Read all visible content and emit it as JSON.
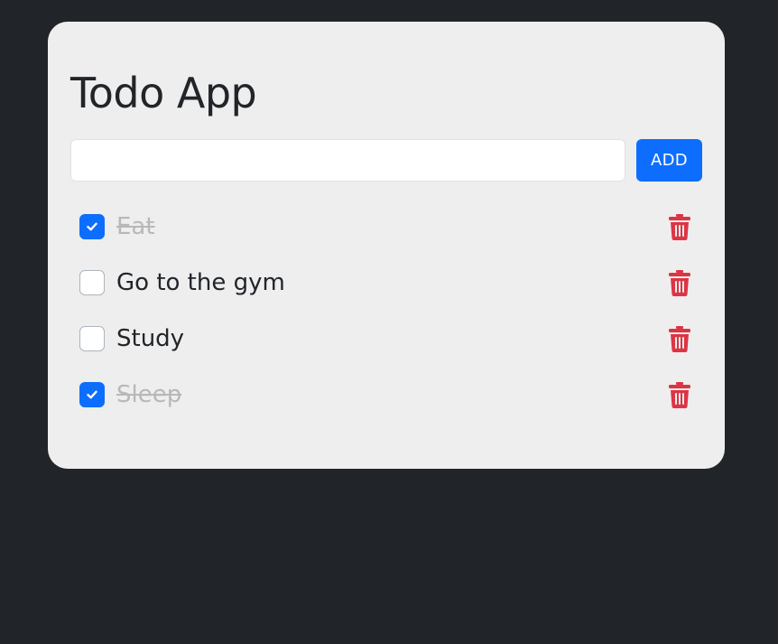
{
  "app": {
    "title": "Todo App"
  },
  "add_form": {
    "input_value": "",
    "input_placeholder": "",
    "add_label": "ADD"
  },
  "todos": [
    {
      "label": "Eat",
      "checked": true
    },
    {
      "label": "Go to the gym",
      "checked": false
    },
    {
      "label": "Study",
      "checked": false
    },
    {
      "label": "Sleep",
      "checked": true
    }
  ],
  "icons": {
    "check": "check-icon",
    "delete": "trash-icon"
  },
  "colors": {
    "page_background": "#212529",
    "card_background": "#eeeeee",
    "accent": "#0d6efd",
    "danger": "#dc3545",
    "done_text": "#b8b8b8"
  }
}
